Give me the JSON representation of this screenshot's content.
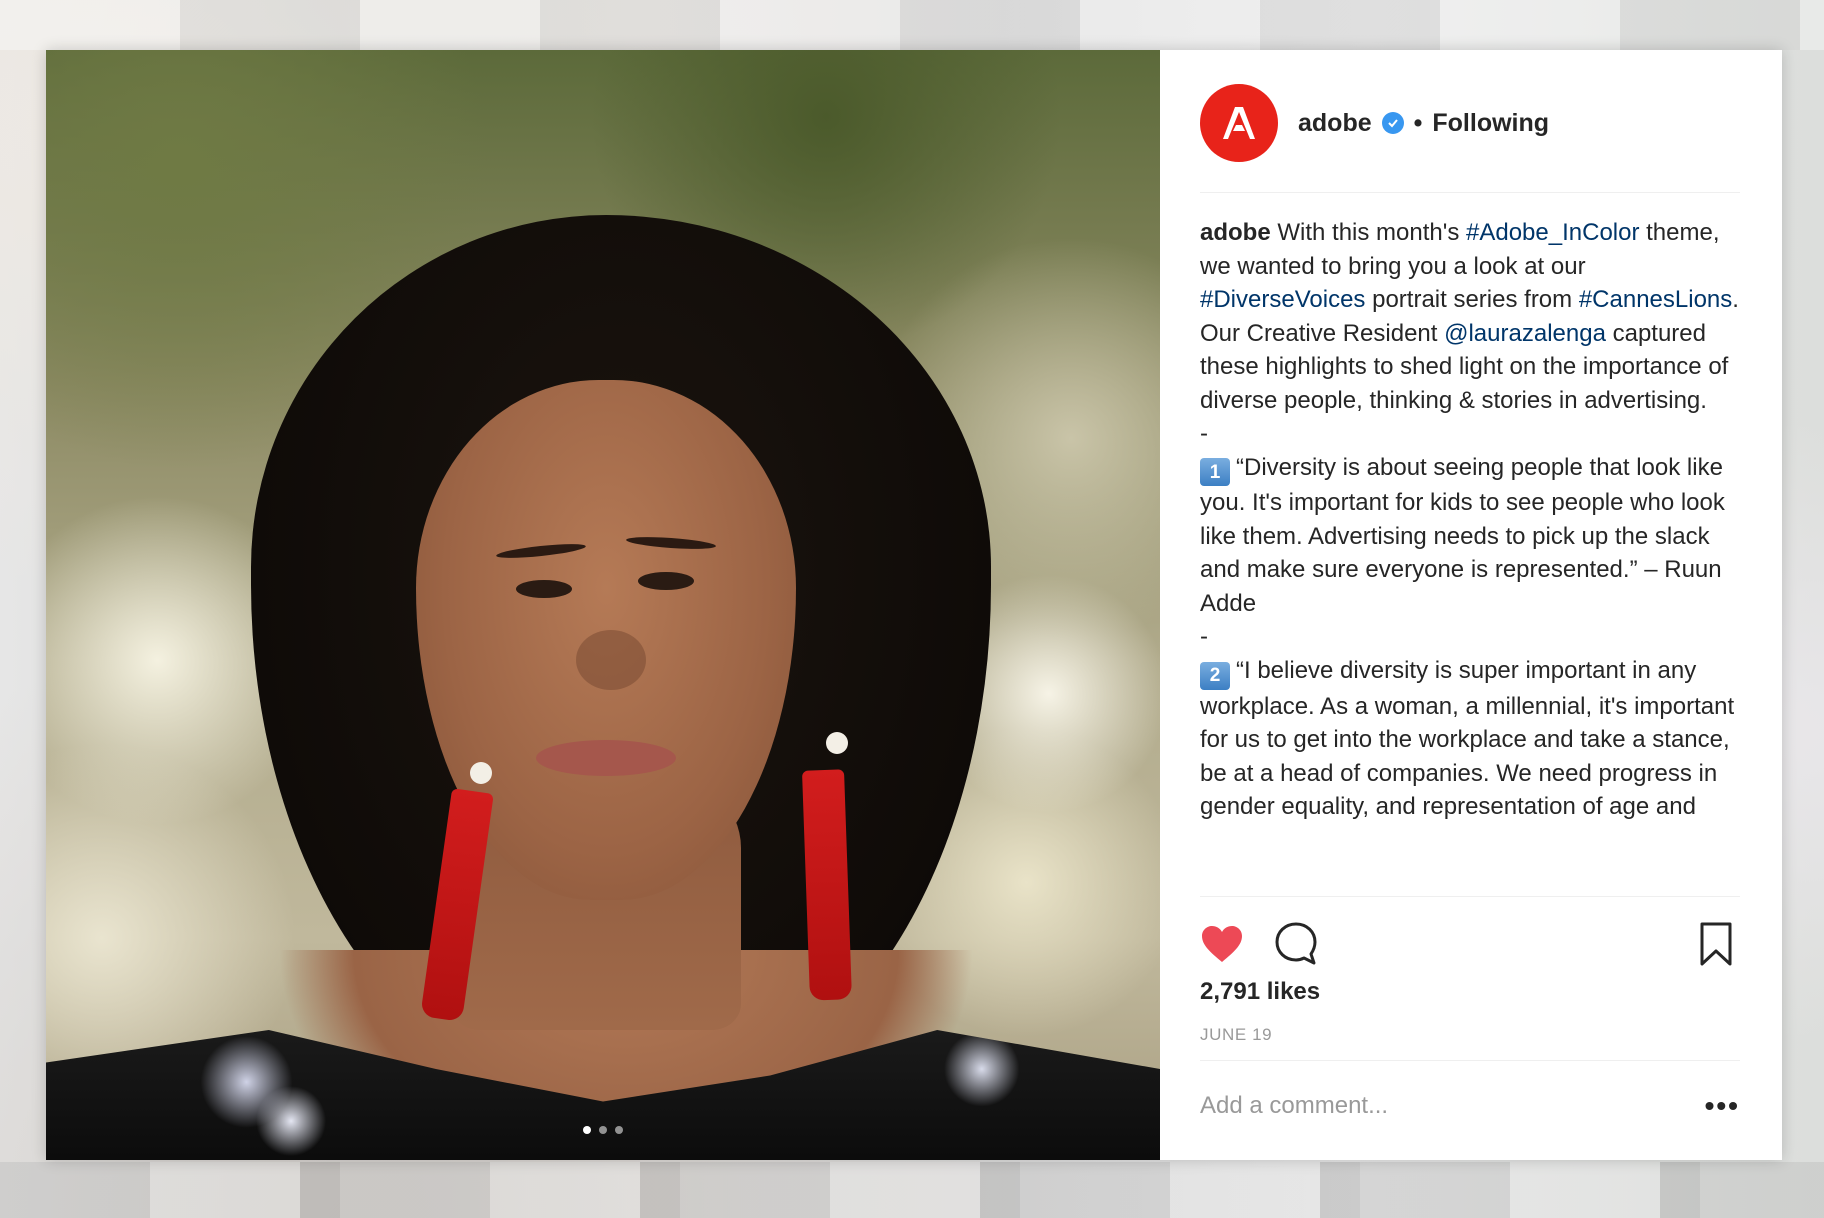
{
  "post": {
    "username": "adobe",
    "separator": "•",
    "follow_status": "Following",
    "caption": {
      "username": "adobe",
      "intro_1": "With this month's",
      "tag_1": "#Adobe_InColor",
      "intro_2": "theme, we wanted to bring you a look at our",
      "tag_2": "#DiverseVoices",
      "intro_3": "portrait series from",
      "tag_3": "#CannesLions",
      "intro_4": ". Our Creative Resident",
      "mention": "@laurazalenga",
      "intro_5": "captured these highlights to shed light on the importance of diverse people, thinking & stories in advertising.",
      "dash_1": "-",
      "quote_1_number": "1",
      "quote_1": "“Diversity is about seeing people that look like you. It's important for kids to see people who look like them. Advertising needs to pick up the slack and make sure everyone is represented.” – Ruun Adde",
      "dash_2": "-",
      "quote_2_number": "2",
      "quote_2": "“I believe diversity is super important in any workplace. As a woman, a millennial, it's important for us to get into the workplace and take a stance, be at a head of companies. We need progress in gender equality, and representation of age and"
    },
    "likes": "2,791 likes",
    "date": "JUNE 19",
    "comment_placeholder": "Add a comment...",
    "more_label": "•••",
    "carousel": {
      "count": 3,
      "active_index": 0
    },
    "liked": true,
    "colors": {
      "brand_red": "#e8231a",
      "heart_red": "#ed4956",
      "link_blue": "#003569",
      "verified_blue": "#3897f0"
    },
    "icons": [
      "adobe-logo-icon",
      "verified-badge-icon",
      "heart-icon",
      "comment-icon",
      "bookmark-icon",
      "more-options-icon"
    ]
  }
}
